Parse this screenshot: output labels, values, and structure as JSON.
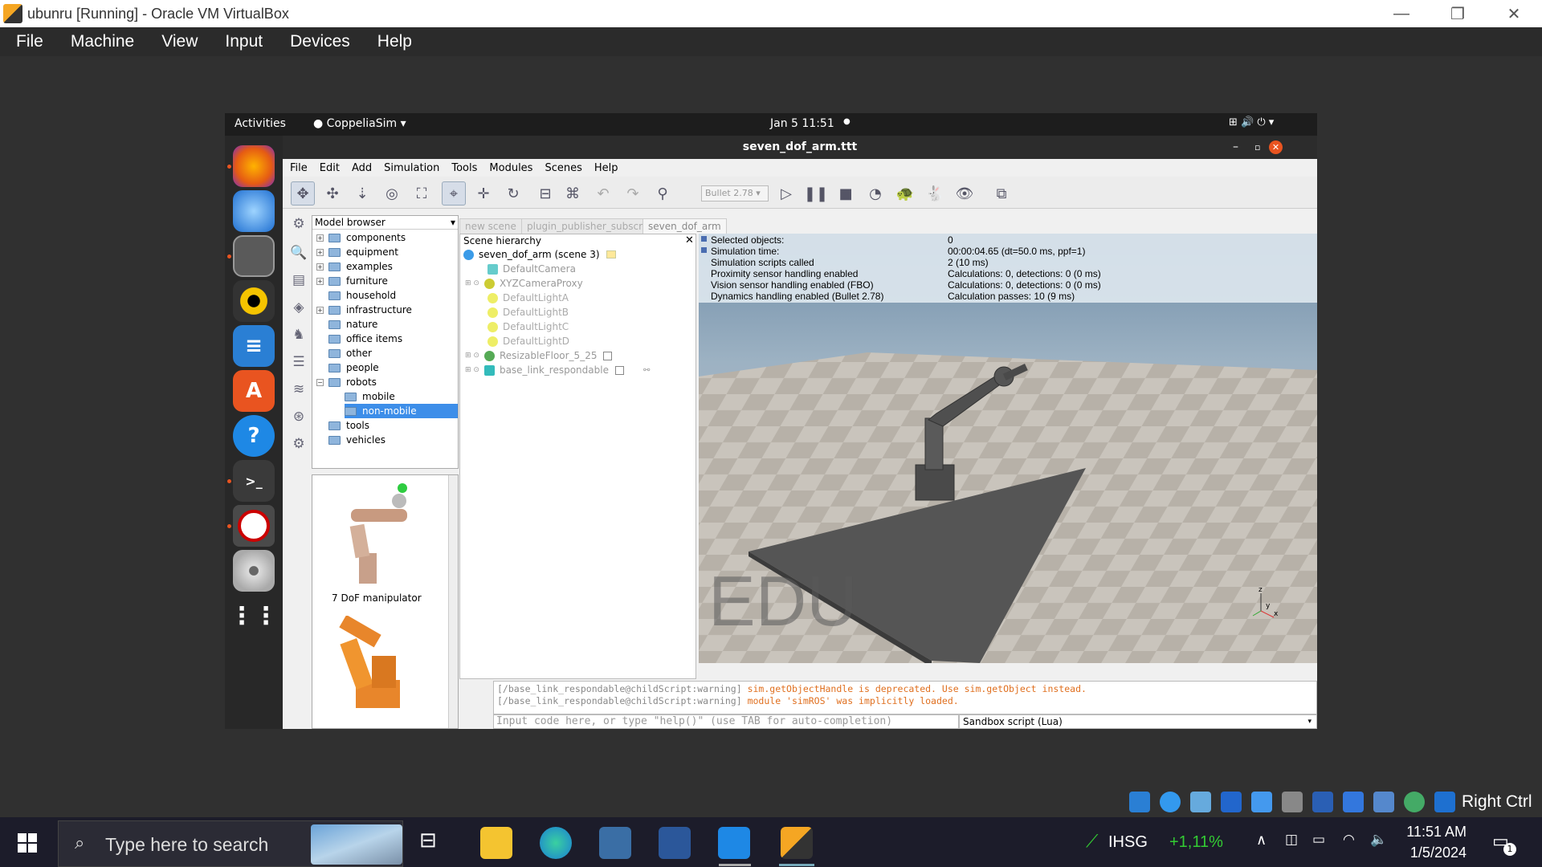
{
  "vbox": {
    "title": "ubunru [Running] - Oracle VM VirtualBox",
    "menu": [
      "File",
      "Machine",
      "View",
      "Input",
      "Devices",
      "Help"
    ]
  },
  "gnome": {
    "activities": "Activities",
    "app": "CoppeliaSim",
    "datetime": "Jan 5  11:51"
  },
  "coppelia": {
    "window_title": "seven_dof_arm.ttt",
    "menu": [
      "File",
      "Edit",
      "Add",
      "Simulation",
      "Tools",
      "Modules",
      "Scenes",
      "Help"
    ],
    "engine": "Bullet 2.78",
    "tabs": [
      "new scene",
      "plugin_publisher_subscriber",
      "seven_dof_arm"
    ],
    "model_browser": {
      "header": "Model browser",
      "items": [
        "components",
        "equipment",
        "examples",
        "furniture",
        "household",
        "infrastructure",
        "nature",
        "office items",
        "other",
        "people",
        "robots",
        "mobile",
        "non-mobile",
        "tools",
        "vehicles"
      ],
      "thumb_label": "7 DoF manipulator"
    },
    "scene": {
      "header": "Scene hierarchy",
      "root": "seven_dof_arm (scene 3)",
      "items": [
        "DefaultCamera",
        "XYZCameraProxy",
        "DefaultLightA",
        "DefaultLightB",
        "DefaultLightC",
        "DefaultLightD",
        "ResizableFloor_5_25",
        "base_link_respondable"
      ]
    },
    "info": {
      "labels": [
        "Selected objects:",
        "Simulation time:",
        "Simulation scripts called",
        "Proximity sensor handling enabled",
        "Vision sensor handling enabled (FBO)",
        "Dynamics handling enabled (Bullet 2.78)"
      ],
      "values": [
        "0",
        "00:00:04.65 (dt=50.0 ms, ppf=1)",
        "2 (10 ms)",
        "Calculations: 0, detections: 0 (0 ms)",
        "Calculations: 0, detections: 0 (0 ms)",
        "Calculation passes: 10 (9 ms)"
      ]
    },
    "watermark": "EDU",
    "console": {
      "l1a": "[/base_link_respondable@childScript:warning]",
      "l1b": "sim.getObjectHandle is deprecated. Use sim.getObject instead.",
      "l2a": "[/base_link_respondable@childScript:warning]",
      "l2b": "module 'simROS' was implicitly loaded."
    },
    "input_placeholder": "Input code here, or type \"help()\" (use TAB for auto-completion)",
    "script_type": "Sandbox script (Lua)"
  },
  "taskbar": {
    "search": "Type here to search",
    "stock": "IHSG",
    "stock_change": "+1,11%",
    "time": "11:51 AM",
    "date": "1/5/2024",
    "right_ctrl": "Right Ctrl",
    "notif": "1"
  }
}
